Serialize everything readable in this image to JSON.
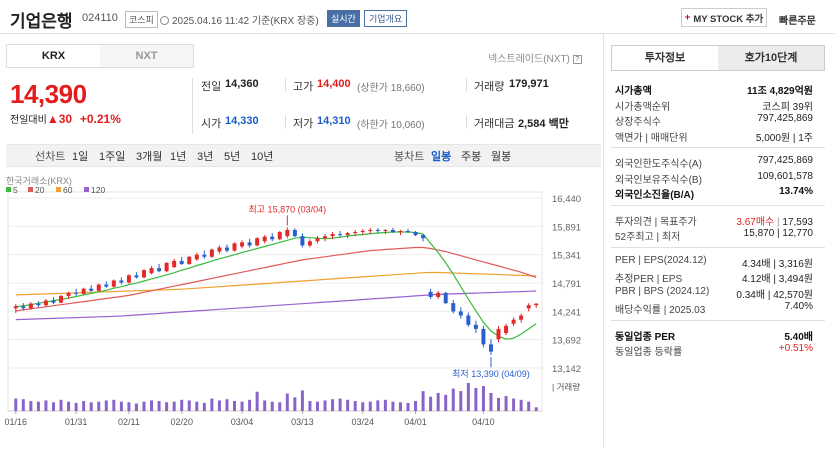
{
  "header": {
    "stock_name": "기업은행",
    "stock_code": "024110",
    "market": "코스피",
    "datetime": "2025.04.16 11:42",
    "basis": "기준(KRX 장중)",
    "live_label": "실시간",
    "corp_label": "기업개요",
    "mystock_label": "MY STOCK 추가",
    "quick_order_label": "빠른주문"
  },
  "market_tabs": [
    "KRX",
    "NXT"
  ],
  "nxt_label": "넥스트레이드(NXT)",
  "quote": {
    "price": "14,390",
    "change_prefix": "전일대비",
    "change_arrow": "▲",
    "change": "30",
    "change_pct": "+0.21%",
    "prev_close_label": "전일",
    "prev_close": "14,360",
    "high_label": "고가",
    "high": "14,400",
    "upper_limit": "(상한가 18,660)",
    "volume_label": "거래량",
    "volume": "179,971",
    "open_label": "시가",
    "open": "14,330",
    "low_label": "저가",
    "low": "14,310",
    "lower_limit": "(하한가 10,060)",
    "amount_label": "거래대금",
    "amount": "2,584",
    "amount_unit": "백만"
  },
  "period_bar": {
    "line_label": "선차트",
    "line_periods": [
      "1일",
      "1주일",
      "3개월",
      "1년",
      "3년",
      "5년",
      "10년"
    ],
    "candle_label": "봉차트",
    "candle_periods": [
      "일봉",
      "주봉",
      "월봉"
    ],
    "active_candle": "일봉"
  },
  "chart_data": {
    "type": "candlestick",
    "title": "한국거래소(KRX)",
    "ma_legend": [
      {
        "name": "5",
        "color": "#3cba3c"
      },
      {
        "name": "20",
        "color": "#e05a5a"
      },
      {
        "name": "60",
        "color": "#f0a030"
      },
      {
        "name": "120",
        "color": "#9a62d0"
      }
    ],
    "y_ticks": [
      "16,440",
      "15,891",
      "15,341",
      "14,791",
      "14,241",
      "13,692",
      "13,142"
    ],
    "ylim": [
      13142,
      16440
    ],
    "x_labels": [
      "01/16",
      "01/31",
      "02/11",
      "02/20",
      "03/04",
      "03/13",
      "03/24",
      "04/01",
      "04/10"
    ],
    "max_annotation": "최고 15,870 (03/04)",
    "min_annotation": "최저 13,390 (04/09)",
    "volume_label": "거래량",
    "candles": [
      [
        14300,
        14380,
        14210,
        14340
      ],
      [
        14340,
        14400,
        14260,
        14300
      ],
      [
        14300,
        14420,
        14270,
        14390
      ],
      [
        14390,
        14440,
        14320,
        14360
      ],
      [
        14360,
        14480,
        14330,
        14450
      ],
      [
        14450,
        14520,
        14380,
        14410
      ],
      [
        14410,
        14560,
        14400,
        14540
      ],
      [
        14540,
        14620,
        14480,
        14600
      ],
      [
        14600,
        14680,
        14540,
        14580
      ],
      [
        14580,
        14700,
        14560,
        14680
      ],
      [
        14680,
        14750,
        14620,
        14640
      ],
      [
        14640,
        14780,
        14620,
        14760
      ],
      [
        14760,
        14820,
        14700,
        14720
      ],
      [
        14720,
        14860,
        14700,
        14840
      ],
      [
        14840,
        14900,
        14760,
        14800
      ],
      [
        14800,
        14960,
        14780,
        14940
      ],
      [
        14940,
        15000,
        14880,
        14900
      ],
      [
        14900,
        15060,
        14880,
        15040
      ],
      [
        14980,
        15120,
        14960,
        15080
      ],
      [
        15080,
        15160,
        15000,
        15020
      ],
      [
        15020,
        15200,
        15000,
        15180
      ],
      [
        15100,
        15260,
        15080,
        15220
      ],
      [
        15220,
        15300,
        15140,
        15160
      ],
      [
        15160,
        15320,
        15140,
        15300
      ],
      [
        15250,
        15380,
        15220,
        15340
      ],
      [
        15340,
        15420,
        15260,
        15300
      ],
      [
        15300,
        15460,
        15280,
        15440
      ],
      [
        15400,
        15520,
        15360,
        15480
      ],
      [
        15480,
        15540,
        15380,
        15420
      ],
      [
        15420,
        15580,
        15400,
        15560
      ],
      [
        15500,
        15620,
        15460,
        15580
      ],
      [
        15580,
        15650,
        15480,
        15520
      ],
      [
        15520,
        15680,
        15500,
        15660
      ],
      [
        15600,
        15720,
        15560,
        15690
      ],
      [
        15690,
        15760,
        15600,
        15640
      ],
      [
        15640,
        15800,
        15620,
        15780
      ],
      [
        15700,
        15870,
        15660,
        15820
      ],
      [
        15820,
        15850,
        15680,
        15700
      ],
      [
        15700,
        15760,
        15480,
        15520
      ],
      [
        15520,
        15640,
        15480,
        15600
      ],
      [
        15600,
        15700,
        15560,
        15660
      ],
      [
        15660,
        15740,
        15600,
        15700
      ],
      [
        15700,
        15780,
        15640,
        15740
      ],
      [
        15740,
        15800,
        15680,
        15720
      ],
      [
        15720,
        15780,
        15660,
        15760
      ],
      [
        15760,
        15820,
        15700,
        15780
      ],
      [
        15780,
        15840,
        15720,
        15800
      ],
      [
        15800,
        15860,
        15740,
        15820
      ],
      [
        15820,
        15860,
        15760,
        15800
      ],
      [
        15800,
        15840,
        15740,
        15820
      ],
      [
        15820,
        15860,
        15760,
        15780
      ],
      [
        15780,
        15820,
        15720,
        15800
      ],
      [
        15800,
        15840,
        15760,
        15780
      ],
      [
        15780,
        15800,
        15700,
        15720
      ],
      [
        15720,
        15740,
        15600,
        15660
      ],
      [
        14620,
        14680,
        14480,
        14520
      ],
      [
        14520,
        14640,
        14480,
        14600
      ],
      [
        14600,
        14620,
        14380,
        14400
      ],
      [
        14400,
        14460,
        14200,
        14240
      ],
      [
        14240,
        14320,
        14100,
        14160
      ],
      [
        14160,
        14220,
        13940,
        13980
      ],
      [
        13980,
        14060,
        13820,
        13900
      ],
      [
        13900,
        13960,
        13540,
        13600
      ],
      [
        13600,
        13700,
        13390,
        13460
      ],
      [
        13700,
        13960,
        13640,
        13900
      ],
      [
        13820,
        14000,
        13780,
        13960
      ],
      [
        14000,
        14120,
        13960,
        14080
      ],
      [
        14080,
        14200,
        14020,
        14160
      ],
      [
        14300,
        14400,
        14240,
        14360
      ],
      [
        14360,
        14400,
        14310,
        14390
      ]
    ],
    "volumes": [
      40,
      38,
      32,
      30,
      34,
      28,
      36,
      30,
      26,
      32,
      28,
      30,
      34,
      36,
      30,
      28,
      24,
      30,
      34,
      32,
      28,
      30,
      36,
      34,
      30,
      26,
      40,
      34,
      38,
      32,
      30,
      36,
      62,
      34,
      30,
      28,
      56,
      44,
      66,
      32,
      30,
      34,
      38,
      40,
      36,
      32,
      28,
      30,
      34,
      36,
      30,
      28,
      26,
      32,
      64,
      46,
      58,
      52,
      72,
      64,
      90,
      74,
      80,
      58,
      42,
      48,
      40,
      36,
      30,
      12
    ],
    "ma5": [
      14330,
      14350,
      14370,
      14400,
      14420,
      14450,
      14470,
      14500,
      14530,
      14560,
      14590,
      14620,
      14650,
      14690,
      14720,
      14760,
      14790,
      14830,
      14870,
      14910,
      14950,
      14990,
      15040,
      15080,
      15130,
      15170,
      15220,
      15260,
      15300,
      15340,
      15380,
      15420,
      15460,
      15500,
      15540,
      15580,
      15620,
      15660,
      15680,
      15670,
      15660,
      15650,
      15660,
      15680,
      15700,
      15720,
      15730,
      15750,
      15760,
      15770,
      15780,
      15780,
      15780,
      15770,
      15740,
      15560,
      15380,
      15180,
      14960,
      14720,
      14480,
      14250,
      14030,
      13860,
      13760,
      13700,
      13720,
      13800,
      13900,
      14000
    ],
    "ma20": [
      14250,
      14270,
      14290,
      14310,
      14330,
      14350,
      14370,
      14390,
      14410,
      14430,
      14450,
      14470,
      14490,
      14510,
      14530,
      14550,
      14580,
      14610,
      14640,
      14670,
      14700,
      14730,
      14760,
      14790,
      14820,
      14850,
      14880,
      14910,
      14940,
      14970,
      15000,
      15030,
      15060,
      15090,
      15120,
      15150,
      15180,
      15210,
      15240,
      15260,
      15280,
      15300,
      15320,
      15340,
      15360,
      15380,
      15400,
      15420,
      15430,
      15440,
      15450,
      15460,
      15470,
      15480,
      15480,
      15460,
      15430,
      15400,
      15360,
      15320,
      15280,
      15240,
      15200,
      15160,
      15120,
      15080,
      15040,
      15000,
      14950,
      14900
    ],
    "ma60": [
      14560,
      14565,
      14570,
      14575,
      14580,
      14585,
      14590,
      14595,
      14600,
      14605,
      14610,
      14615,
      14620,
      14625,
      14630,
      14635,
      14640,
      14645,
      14650,
      14655,
      14660,
      14665,
      14670,
      14680,
      14690,
      14700,
      14710,
      14720,
      14730,
      14740,
      14750,
      14760,
      14770,
      14780,
      14790,
      14800,
      14810,
      14820,
      14830,
      14840,
      14850,
      14860,
      14870,
      14880,
      14890,
      14900,
      14910,
      14920,
      14930,
      14940,
      14950,
      14960,
      14970,
      14980,
      14990,
      14995,
      14995,
      14990,
      14985,
      14980,
      14975,
      14970,
      14965,
      14960,
      14955,
      14950,
      14945,
      14940,
      14935,
      14930
    ],
    "ma120": [
      14080,
      14085,
      14090,
      14095,
      14100,
      14105,
      14110,
      14115,
      14120,
      14125,
      14130,
      14135,
      14140,
      14145,
      14150,
      14160,
      14170,
      14180,
      14190,
      14200,
      14210,
      14220,
      14230,
      14240,
      14250,
      14260,
      14270,
      14280,
      14290,
      14300,
      14310,
      14320,
      14330,
      14340,
      14350,
      14360,
      14370,
      14380,
      14390,
      14400,
      14410,
      14420,
      14430,
      14440,
      14450,
      14460,
      14470,
      14480,
      14490,
      14500,
      14510,
      14520,
      14530,
      14540,
      14550,
      14560,
      14570,
      14575,
      14580,
      14585,
      14590,
      14595,
      14600,
      14605,
      14610,
      14615,
      14620,
      14625,
      14630,
      14635
    ]
  },
  "right_tabs": [
    "투자정보",
    "호가10단계"
  ],
  "invest_info": {
    "rows1": [
      {
        "k": "시가총액",
        "v": "11조 4,829억원",
        "bold": true
      },
      {
        "k": "시가총액순위",
        "v": "코스피 39위"
      },
      {
        "k": "상장주식수",
        "v": "797,425,869"
      },
      {
        "k": "액면가 | 매매단위",
        "v": "5,000원 | 1주"
      }
    ],
    "rows2": [
      {
        "k": "외국인한도주식수(A)",
        "v": "797,425,869"
      },
      {
        "k": "외국인보유주식수(B)",
        "v": "109,601,578"
      },
      {
        "k": "외국인소진율(B/A)",
        "v": "13.74%",
        "bold": true
      }
    ],
    "rows3": [
      {
        "k": "투자의견 | 목표주가",
        "v1": "3.67매수",
        "v2": "17,593"
      },
      {
        "k": "52주최고 | 최저",
        "v": "15,870 | 12,770"
      }
    ],
    "rows4": [
      {
        "k": "PER | EPS(2024.12)",
        "v": "4.34배 | 3,316원"
      },
      {
        "k": "추정PER | EPS",
        "v": "4.12배 | 3,494원"
      },
      {
        "k": "PBR | BPS (2024.12)",
        "v": "0.34배 | 42,570원"
      },
      {
        "k": "배당수익률 | 2025.03",
        "v": "7.40%"
      }
    ],
    "rows5": [
      {
        "k": "동일업종 PER",
        "v": "5.40배",
        "bold": true
      },
      {
        "k": "동일업종 등락률",
        "v": "+0.51%",
        "red": true
      }
    ]
  }
}
